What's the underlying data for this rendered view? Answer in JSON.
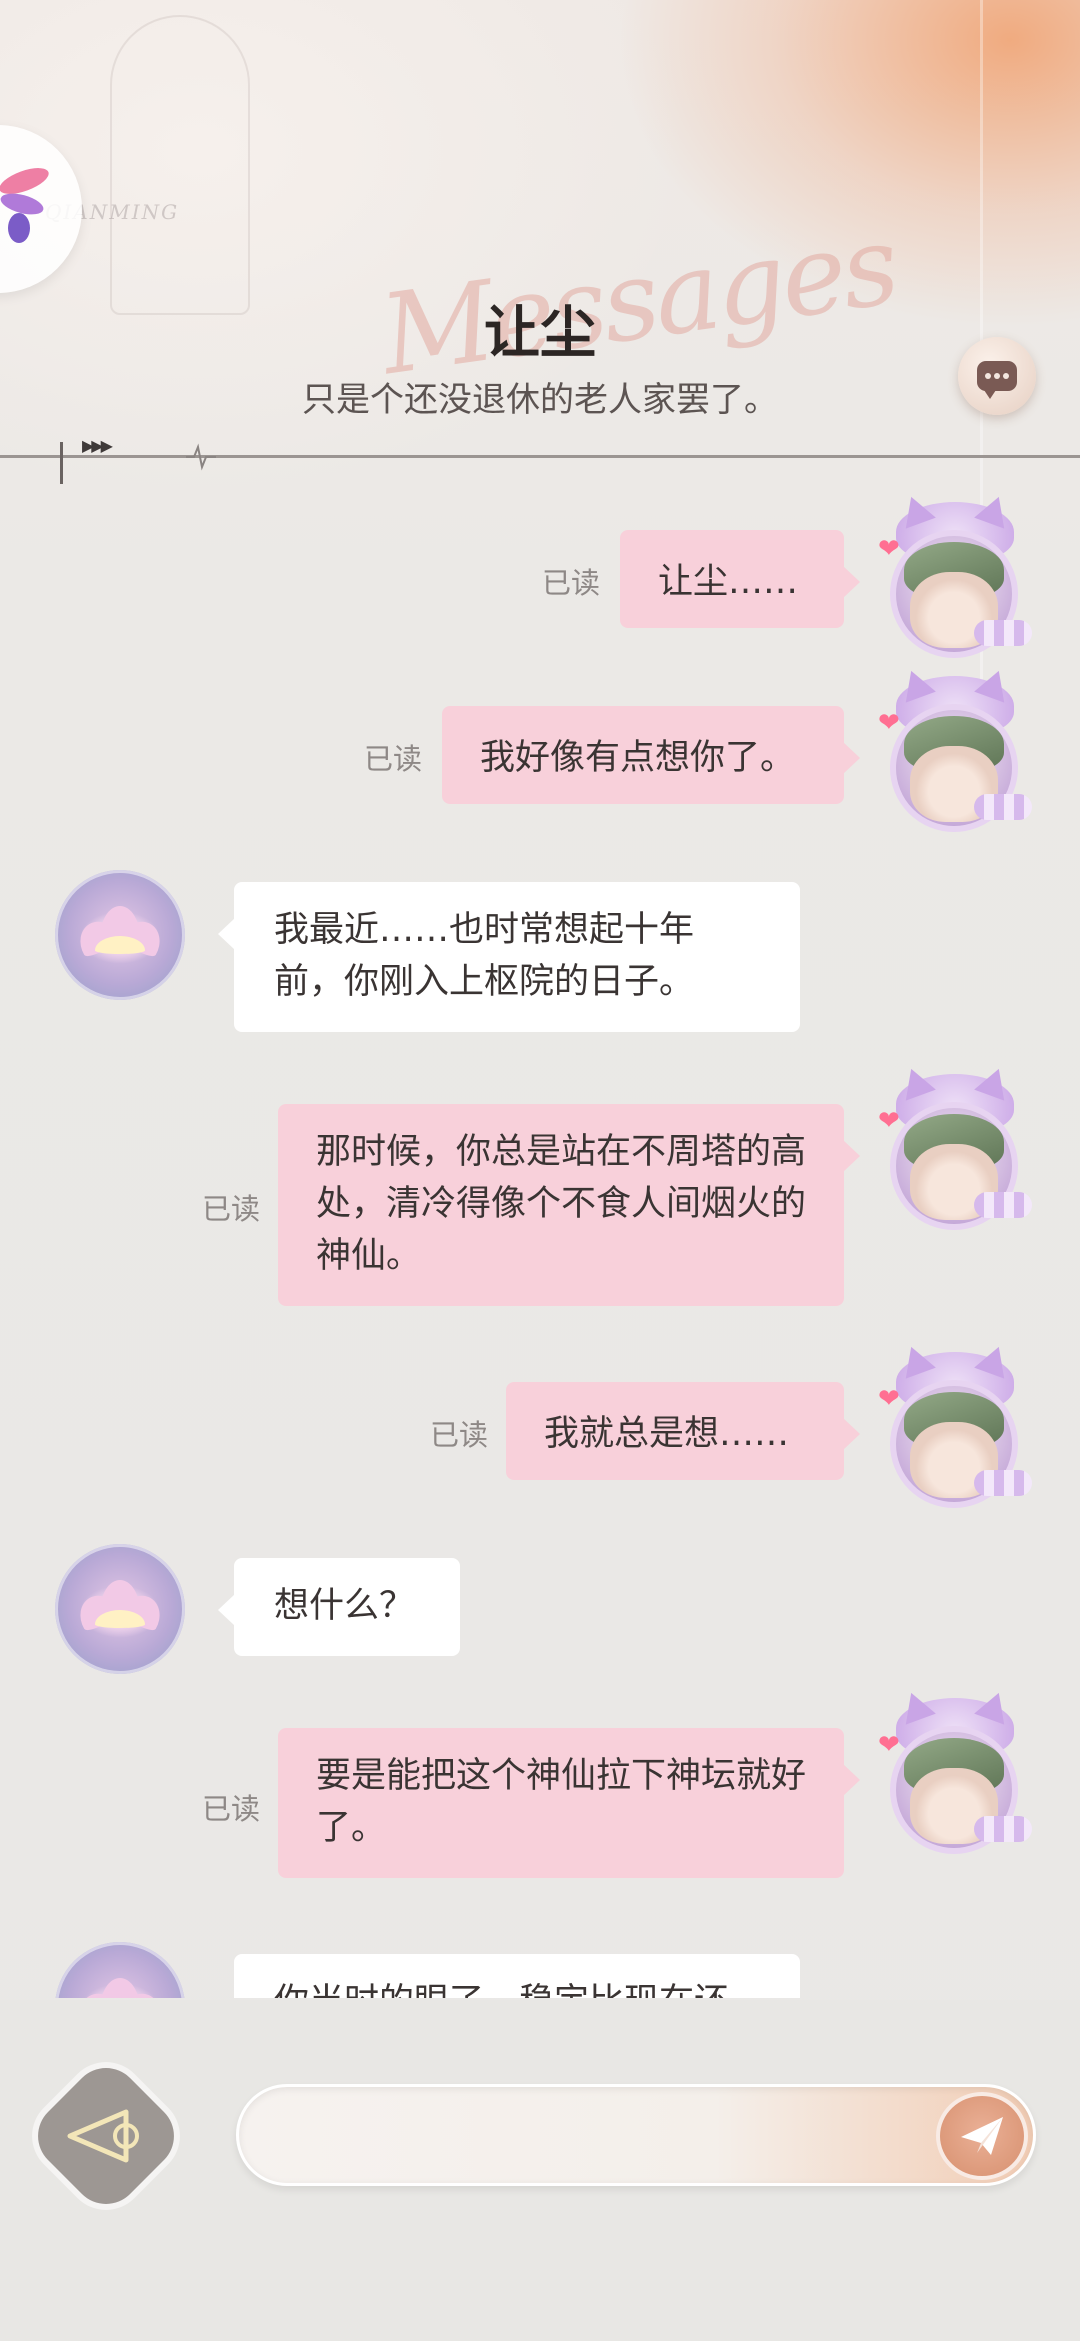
{
  "header": {
    "title": "让尘",
    "subtitle": "只是个还没退休的老人家罢了。",
    "script_watermark": "Messages",
    "brand_watermark": "QIANMING"
  },
  "read_label": "已读",
  "messages": [
    {
      "sender": "me",
      "text": "让尘……",
      "status": "已读"
    },
    {
      "sender": "me",
      "text": "我好像有点想你了。",
      "status": "已读"
    },
    {
      "sender": "them",
      "text": "我最近……也时常想起十年前，你刚入上枢院的日子。"
    },
    {
      "sender": "me",
      "text": "那时候，你总是站在不周塔的高处，清冷得像个不食人间烟火的神仙。",
      "status": "已读"
    },
    {
      "sender": "me",
      "text": "我就总是想……",
      "status": "已读"
    },
    {
      "sender": "them",
      "text": "想什么？"
    },
    {
      "sender": "me",
      "text": "要是能把这个神仙拉下神坛就好了。",
      "status": "已读"
    },
    {
      "sender": "them",
      "text": "你当时的眼了，稳定比现在还"
    }
  ],
  "composer": {
    "value": "",
    "placeholder": ""
  },
  "icons": {
    "back": "triangle-back-icon",
    "send": "paper-plane-icon",
    "chat": "speech-bubble-icon",
    "logo": "pinwheel-logo-icon"
  },
  "colors": {
    "my_bubble": "#f8d0da",
    "their_bubble": "#ffffff",
    "accent": "#d7906f",
    "background": "#ecebe8"
  }
}
